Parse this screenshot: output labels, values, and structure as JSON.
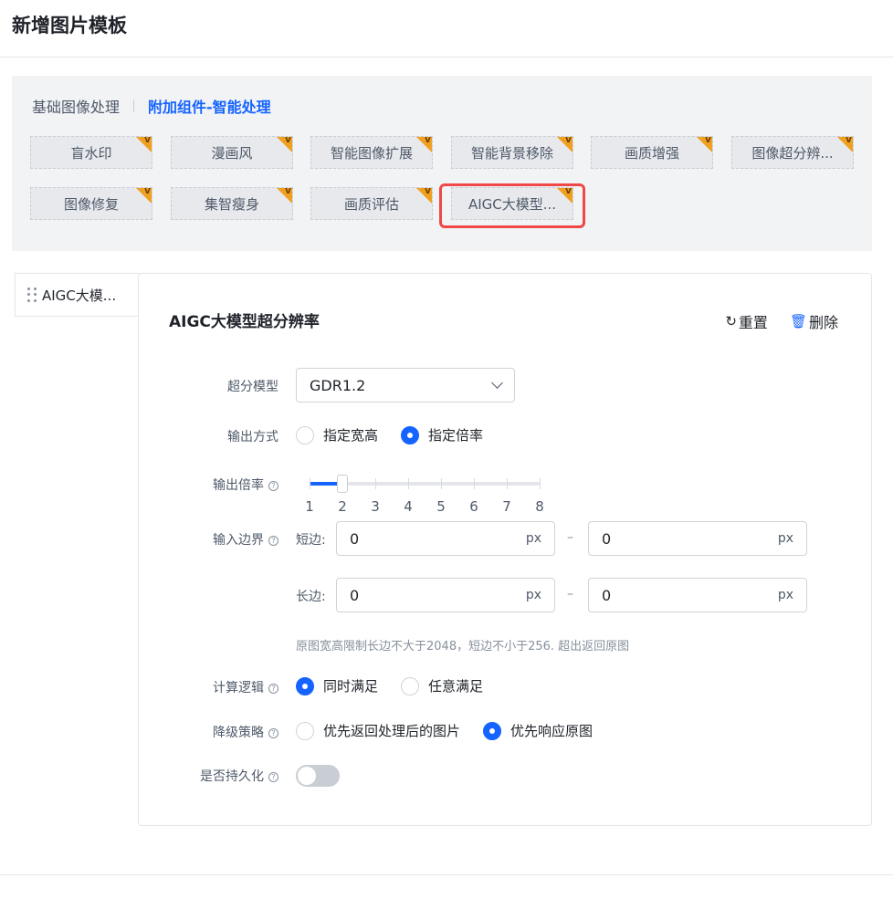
{
  "page": {
    "title": "新增图片模板"
  },
  "component_tabs": [
    {
      "label": "基础图像处理",
      "active": false
    },
    {
      "label": "附加组件-智能处理",
      "active": true
    }
  ],
  "components": {
    "badge_text": "V",
    "items": [
      {
        "label": "盲水印"
      },
      {
        "label": "漫画风"
      },
      {
        "label": "智能图像扩展"
      },
      {
        "label": "智能背景移除"
      },
      {
        "label": "画质增强"
      },
      {
        "label": "图像超分辨..."
      },
      {
        "label": "图像修复"
      },
      {
        "label": "集智瘦身"
      },
      {
        "label": "画质评估"
      },
      {
        "label": "AIGC大模型..."
      }
    ],
    "highlighted_index": 9
  },
  "side_tab": {
    "label": "AIGC大模..."
  },
  "card": {
    "title": "AIGC大模型超分辨率",
    "reset_label": "重置",
    "delete_label": "删除"
  },
  "form": {
    "model": {
      "label": "超分模型",
      "value": "GDR1.2"
    },
    "output_mode": {
      "label": "输出方式",
      "options": [
        "指定宽高",
        "指定倍率"
      ],
      "selected": 1
    },
    "output_scale": {
      "label": "输出倍率",
      "marks": [
        "1",
        "2",
        "3",
        "4",
        "5",
        "6",
        "7",
        "8"
      ],
      "value": 2,
      "min": 1,
      "max": 8
    },
    "input_bounds": {
      "label": "输入边界",
      "short_label": "短边:",
      "long_label": "长边:",
      "short_min": "0",
      "short_max": "0",
      "long_min": "0",
      "long_max": "0",
      "unit": "px",
      "separator": "–",
      "hint": "原图宽高限制长边不大于2048，短边不小于256. 超出返回原图"
    },
    "logic": {
      "label": "计算逻辑",
      "options": [
        "同时满足",
        "任意满足"
      ],
      "selected": 0
    },
    "fallback": {
      "label": "降级策略",
      "options": [
        "优先返回处理后的图片",
        "优先响应原图"
      ],
      "selected": 1
    },
    "persist": {
      "label": "是否持久化",
      "enabled": false
    }
  },
  "colors": {
    "accent": "#1664ff",
    "badge": "#f0a020",
    "highlight": "#f04848"
  }
}
